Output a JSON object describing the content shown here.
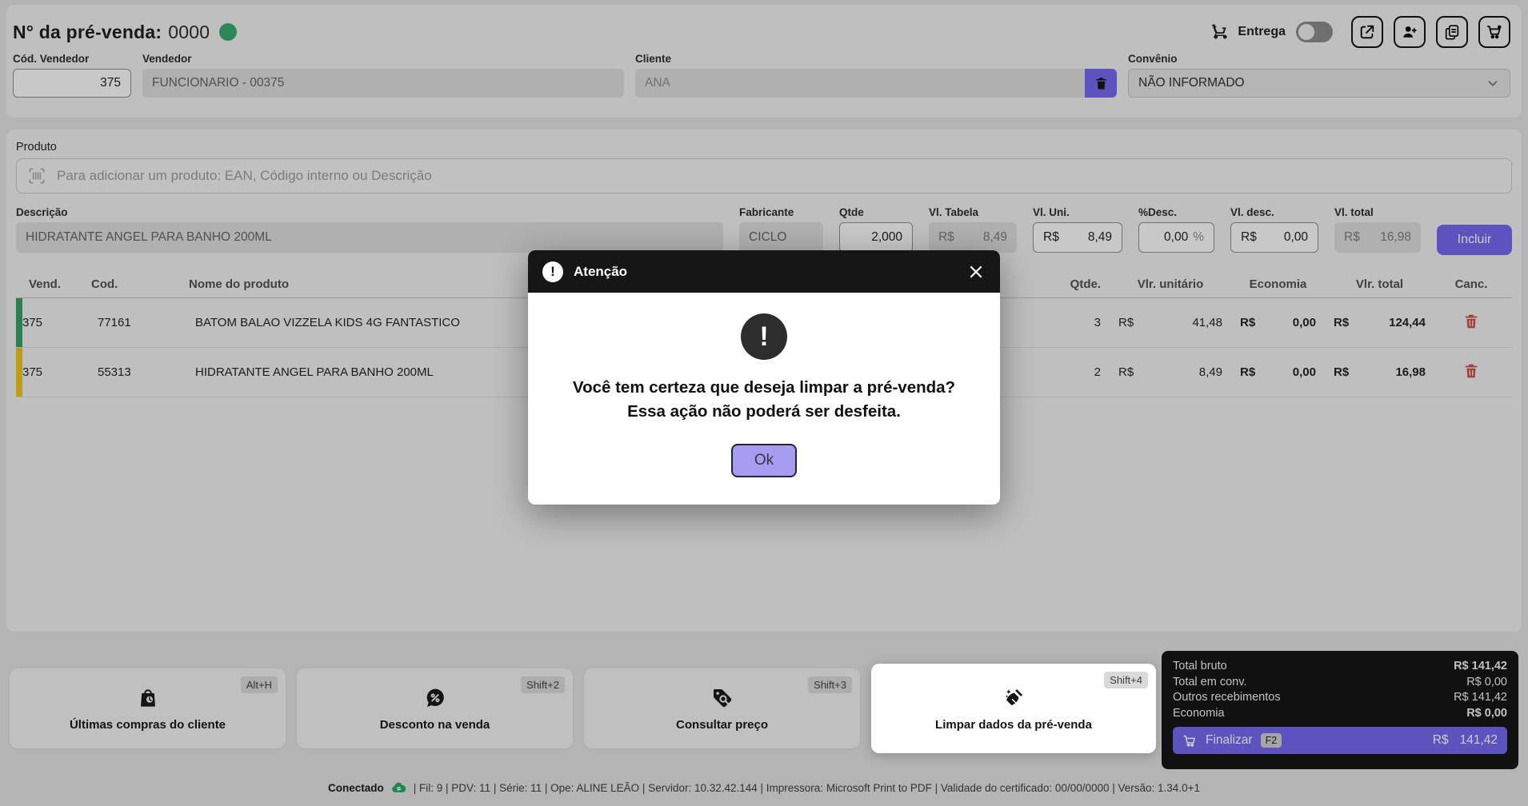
{
  "header": {
    "title_label": "N° da pré-venda:",
    "title_value": "0000",
    "entrega_label": "Entrega"
  },
  "fields": {
    "cod_vendedor": {
      "label": "Cód. Vendedor",
      "value": "375"
    },
    "vendedor": {
      "label": "Vendedor",
      "value": "FUNCIONARIO - 00375"
    },
    "cliente": {
      "label": "Cliente",
      "value": "ANA"
    },
    "convenio": {
      "label": "Convênio",
      "value": "NÃO INFORMADO"
    }
  },
  "product_search": {
    "label": "Produto",
    "placeholder": "Para adicionar um produto: EAN, Código interno ou Descrição"
  },
  "product_form": {
    "descricao": {
      "label": "Descrição",
      "value": "HIDRATANTE ANGEL PARA BANHO 200ML"
    },
    "fabricante": {
      "label": "Fabricante",
      "value": "CICLO"
    },
    "qtde": {
      "label": "Qtde",
      "value": "2,000"
    },
    "vl_tabela": {
      "label": "Vl. Tabela",
      "currency": "R$",
      "value": "8,49"
    },
    "vl_uni": {
      "label": "Vl. Uni.",
      "currency": "R$",
      "value": "8,49"
    },
    "desc_pct": {
      "label": "%Desc.",
      "value": "0,00",
      "suffix": "%"
    },
    "vl_desc": {
      "label": "Vl. desc.",
      "currency": "R$",
      "value": "0,00"
    },
    "vl_total": {
      "label": "Vl. total",
      "currency": "R$",
      "value": "16,98"
    },
    "incluir_label": "Incluir"
  },
  "table": {
    "currency": "R$",
    "headers": {
      "vend": "Vend.",
      "cod": "Cod.",
      "nome": "Nome do produto",
      "qtde": "Qtde.",
      "vlr_unitario": "Vlr. unitário",
      "economia": "Economia",
      "vlr_total": "Vlr. total",
      "canc": "Canc."
    },
    "rows": [
      {
        "vend": "375",
        "cod": "77161",
        "nome": "BATOM BALAO VIZZELA KIDS 4G FANTASTICO",
        "qtde": "3",
        "vlr_unitario": "41,48",
        "economia": "0,00",
        "vlr_total": "124,44",
        "stripe": "green"
      },
      {
        "vend": "375",
        "cod": "55313",
        "nome": "HIDRATANTE ANGEL PARA BANHO 200ML",
        "qtde": "2",
        "vlr_unitario": "8,49",
        "economia": "0,00",
        "vlr_total": "16,98",
        "stripe": "yellow"
      }
    ]
  },
  "actions": [
    {
      "label": "Últimas compras do cliente",
      "shortcut": "Alt+H",
      "icon": "bag-clock-icon",
      "highlighted": false
    },
    {
      "label": "Desconto na venda",
      "shortcut": "Shift+2",
      "icon": "percent-bubble-icon",
      "highlighted": false
    },
    {
      "label": "Consultar preço",
      "shortcut": "Shift+3",
      "icon": "tag-search-icon",
      "highlighted": false
    },
    {
      "label": "Limpar dados da pré-venda",
      "shortcut": "Shift+4",
      "icon": "broom-icon",
      "highlighted": true
    }
  ],
  "totals": {
    "rows": [
      {
        "label": "Total bruto",
        "value": "R$ 141,42"
      },
      {
        "label": "Total em conv.",
        "value": "R$ 0,00"
      },
      {
        "label": "Outros recebimentos",
        "value": "R$ 141,42"
      },
      {
        "label": "Economia",
        "value": "R$ 0,00"
      }
    ],
    "finalizar": {
      "label": "Finalizar",
      "shortcut": "F2",
      "currency": "R$",
      "value": "141,42"
    }
  },
  "modal": {
    "title": "Atenção",
    "message_line1": "Você tem certeza que deseja limpar a pré-venda?",
    "message_line2": "Essa ação não poderá ser desfeita.",
    "ok_label": "Ok",
    "warning_glyph": "!"
  },
  "statusbar": {
    "connected": "Conectado",
    "info": "| Fil: 9 | PDV: 11 | Série: 11 | Ope: ALINE LEÃO | Servidor: 10.32.42.144 | Impressora: Microsoft Print to PDF | Validade do certificado: 00/00/0000 | Versão: 1.34.0+1"
  },
  "colors": {
    "accent_purple": "#7367f0",
    "ok_button_purple": "#a89cf2",
    "indicator_green": "#35a96b",
    "stripe_green": "#35a066",
    "stripe_yellow": "#eec41d",
    "delete_red": "#cf4b47",
    "cloud_green": "#21a95e",
    "panel_black": "#131313"
  },
  "icons": {
    "delivery": "moped-icon",
    "share": "share-icon",
    "add_person": "add-person-icon",
    "copy": "copy-icon",
    "cart_notification": "cart-notification-icon",
    "barcode": "barcode-icon",
    "trash": "trash-icon",
    "chevron": "chevron-down-icon",
    "warning": "exclamation-circle-icon",
    "close": "close-icon",
    "cart": "cart-icon",
    "cloud": "cloud-sync-icon"
  }
}
